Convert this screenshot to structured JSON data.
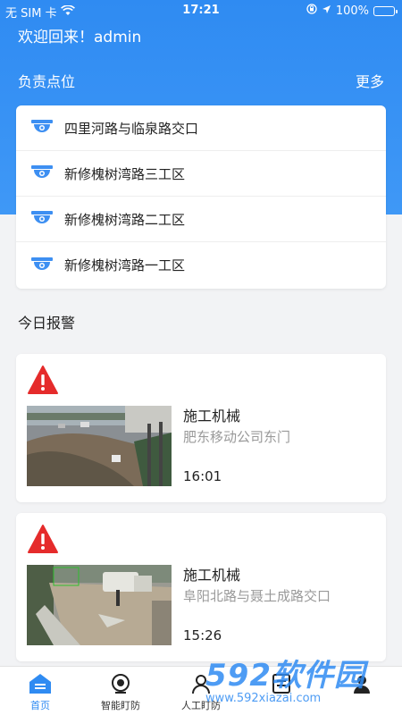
{
  "status_bar": {
    "carrier": "无 SIM 卡",
    "time": "17:21",
    "battery": "100%"
  },
  "welcome": "欢迎回来！admin",
  "spots_section": {
    "title": "负责点位",
    "more": "更多",
    "items": [
      {
        "label": "四里河路与临泉路交口",
        "icon": "camera-icon"
      },
      {
        "label": "新修槐树湾路三工区",
        "icon": "camera-icon"
      },
      {
        "label": "新修槐树湾路二工区",
        "icon": "camera-icon"
      },
      {
        "label": "新修槐树湾路一工区",
        "icon": "camera-icon"
      }
    ]
  },
  "today_section": {
    "title": "今日报警",
    "alerts": [
      {
        "type": "施工机械",
        "location": "肥东移动公司东门",
        "time": "16:01",
        "icon": "warning-icon"
      },
      {
        "type": "施工机械",
        "location": "阜阳北路与聂土成路交口",
        "time": "15:26",
        "icon": "warning-icon"
      }
    ]
  },
  "tabs": [
    {
      "label": "首页",
      "icon": "home-icon",
      "active": true
    },
    {
      "label": "智能盯防",
      "icon": "camera-lens-icon"
    },
    {
      "label": "人工盯防",
      "icon": "person-icon"
    },
    {
      "label": "",
      "icon": "list-icon"
    },
    {
      "label": "",
      "icon": "profile-icon"
    }
  ],
  "watermark": {
    "brand": "592软件园",
    "url": "www.592xiazai.com"
  },
  "colors": {
    "primary": "#2f8bf2",
    "warning": "#e52b2b",
    "background": "#f2f3f5"
  }
}
